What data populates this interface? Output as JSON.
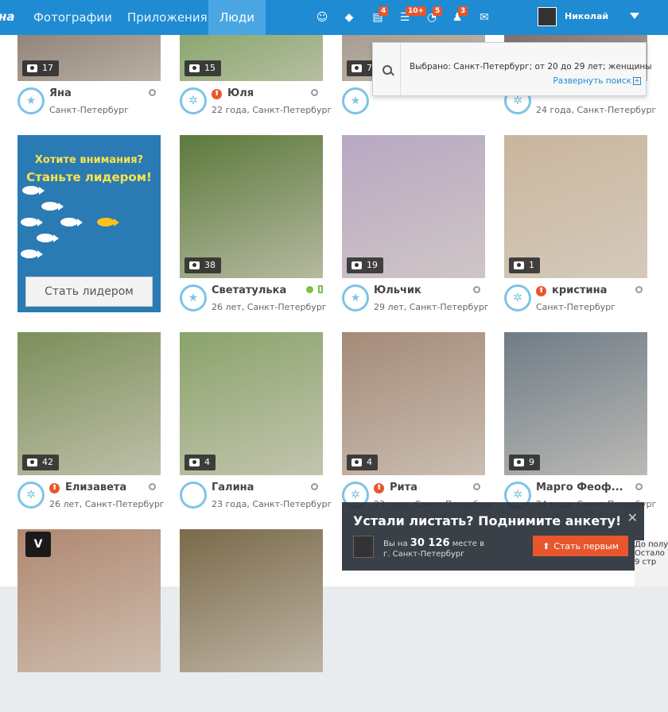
{
  "nav": {
    "brand": "на",
    "items": [
      "Фотографии",
      "Приложения",
      "Люди"
    ],
    "active_index": 2
  },
  "header_icons": [
    {
      "name": "smiley-icon",
      "badge": ""
    },
    {
      "name": "diamond-icon",
      "badge": ""
    },
    {
      "name": "messages-icon",
      "badge": "4"
    },
    {
      "name": "events-icon",
      "badge": "10+"
    },
    {
      "name": "guests-icon",
      "badge": "5"
    },
    {
      "name": "friends-icon",
      "badge": "3"
    },
    {
      "name": "mail-icon",
      "badge": ""
    }
  ],
  "user": {
    "name": "Николай"
  },
  "search": {
    "selected": "Выбрано: Санкт-Петербург; от 20 до 29 лет; женщины",
    "expand": "Развернуть поиск",
    "expand_icon": "+"
  },
  "promo": {
    "line1": "Хотите внимания?",
    "line2": "Станьте лидером!",
    "button": "Стать лидером"
  },
  "profiles": [
    {
      "name": "Яна",
      "meta": "Санкт-Петербург",
      "photos": "17",
      "up": false,
      "rank": "star",
      "status": "offline",
      "bg": "#6b5a4e"
    },
    {
      "name": "Юля",
      "meta": "22 года, Санкт-Петербург",
      "photos": "15",
      "up": true,
      "rank": "stars",
      "status": "offline",
      "bg": "#5f8f3e"
    },
    {
      "name": "",
      "meta": "",
      "photos": "7",
      "up": false,
      "rank": "star",
      "status": "none",
      "bg": "#8c7f72"
    },
    {
      "name": "",
      "meta": "24 года, Санкт-Петербург",
      "photos": "",
      "up": false,
      "rank": "stars",
      "status": "none",
      "bg": "#4a3b37"
    },
    {
      "name": "Светатулька",
      "meta": "26 лет, Санкт-Петербург",
      "photos": "38",
      "up": false,
      "rank": "star",
      "status": "online",
      "bg": "#5c7a3c"
    },
    {
      "name": "Юльчик",
      "meta": "29 лет, Санкт-Петербург",
      "photos": "19",
      "up": false,
      "rank": "star",
      "status": "offline",
      "bg": "#b7a8c2"
    },
    {
      "name": "кристина",
      "meta": "Санкт-Петербург",
      "photos": "1",
      "up": true,
      "rank": "stars",
      "status": "offline",
      "bg": "#c9b59c"
    },
    {
      "name": "Елизавета",
      "meta": "26 лет, Санкт-Петербург",
      "photos": "42",
      "up": true,
      "rank": "stars",
      "status": "offline",
      "bg": "#7c8f5a"
    },
    {
      "name": "Галина",
      "meta": "23 года, Санкт-Петербург",
      "photos": "4",
      "up": false,
      "rank": "empty",
      "status": "offline",
      "bg": "#8aa36b"
    },
    {
      "name": "Рита",
      "meta": "23 года, Санкт-Петербург",
      "photos": "4",
      "up": true,
      "rank": "stars",
      "status": "offline",
      "bg": "#a48a78"
    },
    {
      "name": "Марго Феоф...",
      "meta": "24 года, Санкт-Петербург",
      "photos": "9",
      "up": false,
      "rank": "stars",
      "status": "offline",
      "bg": "#6f7c86"
    },
    {
      "name": "",
      "meta": "",
      "photos": "",
      "up": false,
      "rank": "none",
      "status": "none",
      "bg": "#b08870"
    },
    {
      "name": "",
      "meta": "",
      "photos": "",
      "up": false,
      "rank": "none",
      "status": "none",
      "bg": "#7a6a4a"
    }
  ],
  "boost": {
    "title": "Устали листать? Поднимите анкету!",
    "place_prefix": "Вы на",
    "place": "30 126",
    "place_suffix": "месте в",
    "city": "г. Санкт-Петербург",
    "button": "Стать первым",
    "close": "✕"
  },
  "side_note": {
    "lines": [
      "До полу",
      "",
      "Остало",
      "9 стр"
    ]
  },
  "vk_logo": "V",
  "colors": {
    "topbar": "#1f8bd2",
    "accent_orange": "#e8562e",
    "promo_bg": "#2a7bb3",
    "promo_text": "#ffe24a",
    "online": "#7bc043"
  }
}
